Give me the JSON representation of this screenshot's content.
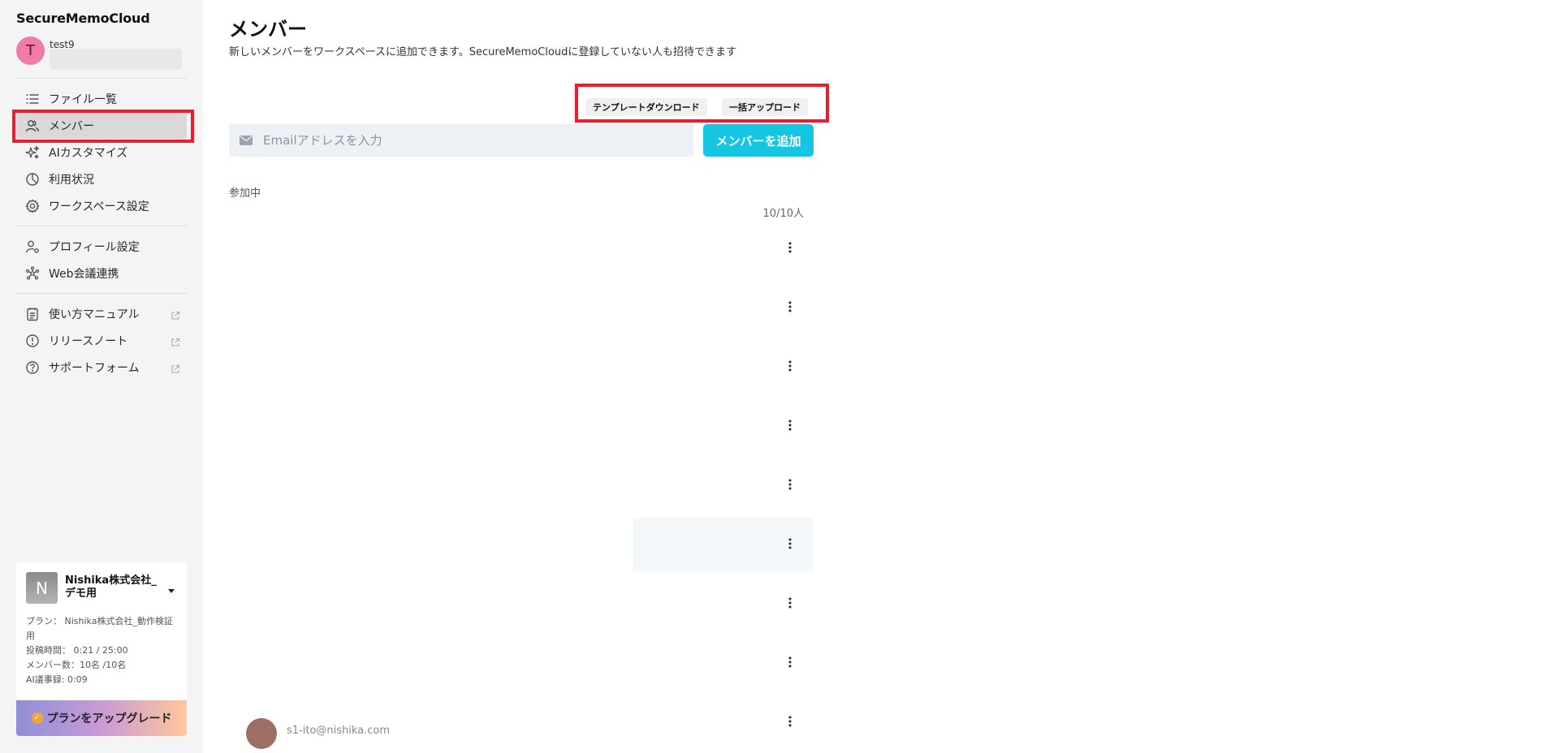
{
  "sidebar": {
    "brand": "SecureMemoCloud",
    "user": {
      "initial": "T",
      "name": "test9"
    },
    "nav_main": [
      {
        "label": "ファイル一覧",
        "icon": "list-icon"
      },
      {
        "label": "メンバー",
        "icon": "members-icon",
        "active": true
      },
      {
        "label": "AIカスタマイズ",
        "icon": "sparkle-icon"
      },
      {
        "label": "利用状況",
        "icon": "pie-chart-icon"
      },
      {
        "label": "ワークスペース設定",
        "icon": "gear-icon"
      }
    ],
    "nav_profile": [
      {
        "label": "プロフィール設定",
        "icon": "person-gear-icon"
      },
      {
        "label": "Web会議連携",
        "icon": "network-icon"
      }
    ],
    "nav_external": [
      {
        "label": "使い方マニュアル",
        "icon": "clipboard-icon"
      },
      {
        "label": "リリースノート",
        "icon": "alert-circle-icon"
      },
      {
        "label": "サポートフォーム",
        "icon": "help-circle-icon"
      }
    ],
    "workspace": {
      "initial": "N",
      "name": "Nishika株式会社_デモ用",
      "plan_line": "プラン： Nishika株式会社_動作検証用",
      "post_time": "投稿時間： 0:21 / 25:00",
      "member_count": "メンバー数：10名 /10名",
      "ai_minutes": "AI議事録: 0:09",
      "upgrade_label": "プランをアップグレード"
    }
  },
  "main": {
    "title": "メンバー",
    "description": "新しいメンバーをワークスペースに追加できます。SecureMemoCloudに登録していない人も招待できます",
    "template_download_label": "テンプレートダウンロード",
    "bulk_upload_label": "一括アップロード",
    "email_placeholder": "Emailアドレスを入力",
    "add_member_label": "メンバーを追加",
    "section_label": "参加中",
    "count_label": "10/10人",
    "last_member_email": "s1-ito@nishika.com"
  },
  "colors": {
    "accent": "#14c6e2",
    "highlight": "#ee1c2c",
    "avatar_user": "#f07aa8"
  }
}
